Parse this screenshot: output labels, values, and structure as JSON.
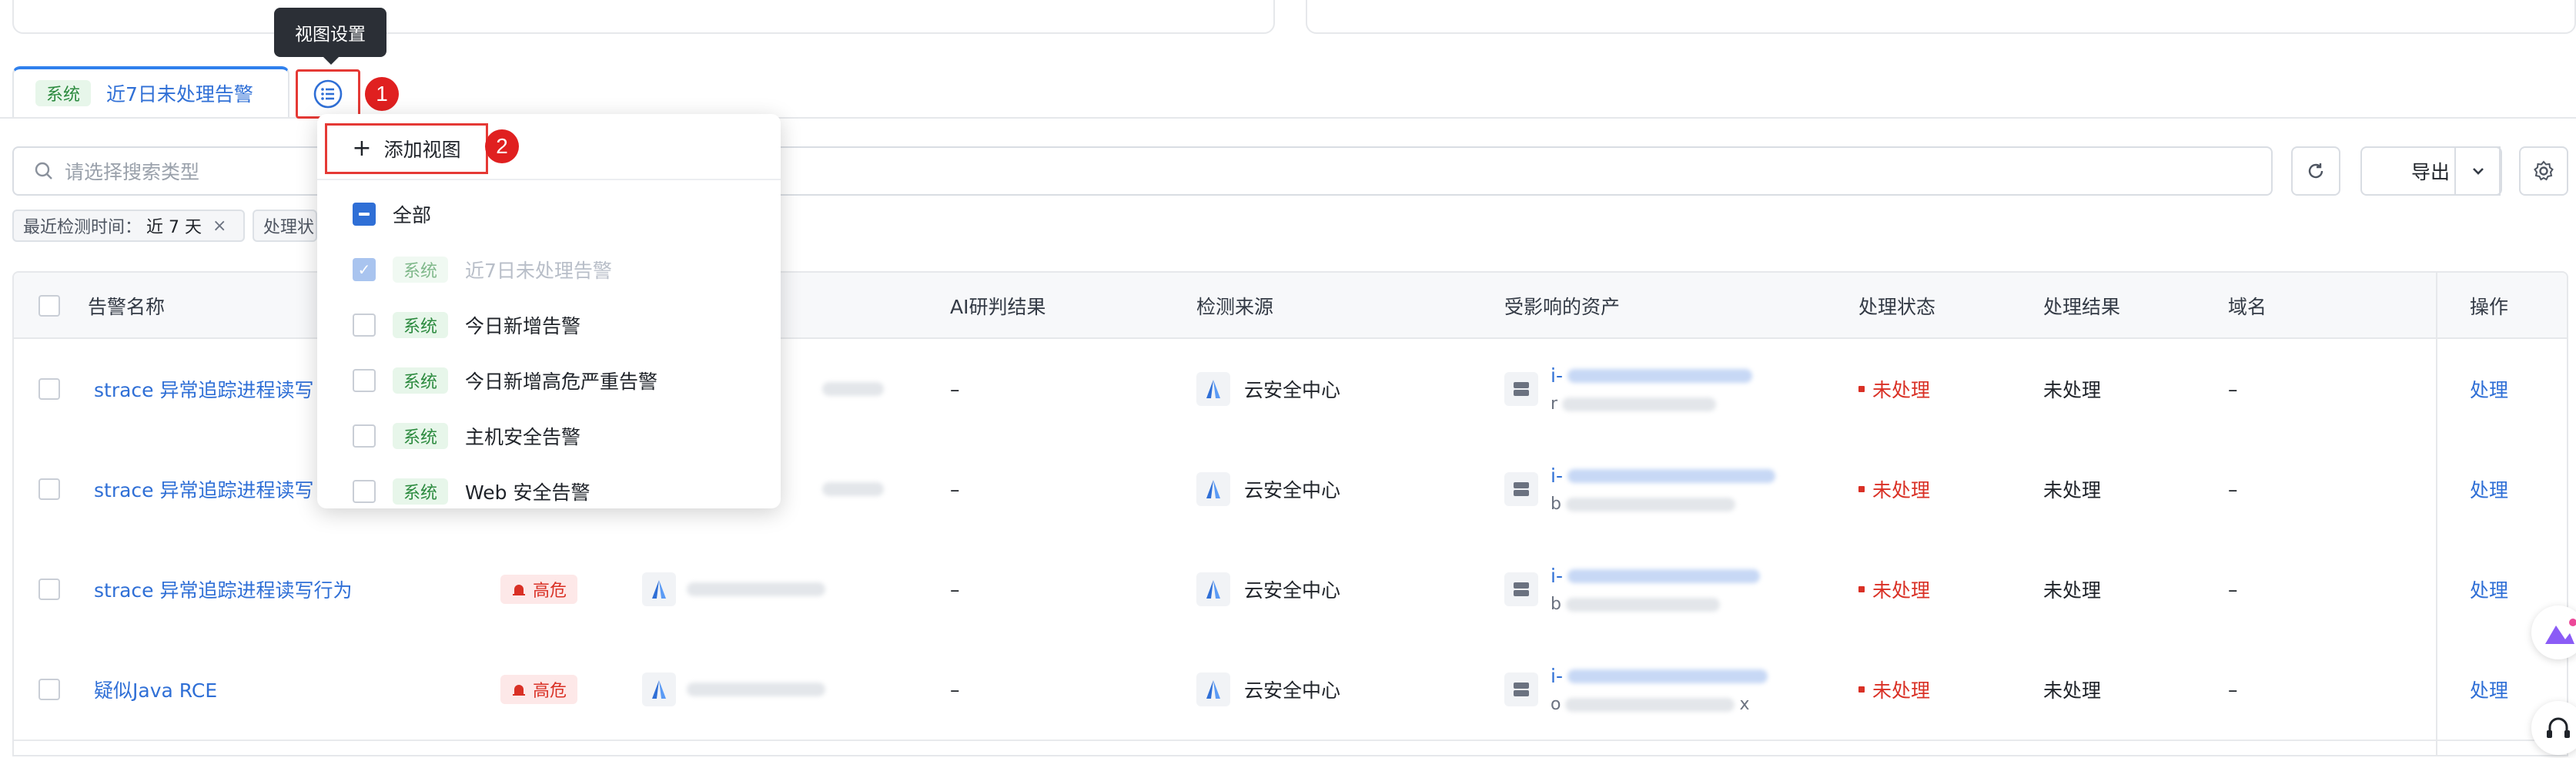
{
  "tooltip": "视图设置",
  "tabs": [
    {
      "tag": "系统",
      "label": "近7日未处理告警"
    },
    {
      "marker": "1"
    }
  ],
  "dropdown": {
    "add_view_label": "添加视图",
    "add_marker": "2",
    "items": [
      {
        "label": "全部",
        "state": "indeterminate",
        "tag": ""
      },
      {
        "label": "近7日未处理告警",
        "state": "checked-disabled",
        "tag": "系统"
      },
      {
        "label": "今日新增告警",
        "state": "unchecked",
        "tag": "系统"
      },
      {
        "label": "今日新增高危严重告警",
        "state": "unchecked",
        "tag": "系统"
      },
      {
        "label": "主机安全告警",
        "state": "unchecked",
        "tag": "系统"
      },
      {
        "label": "Web 安全告警",
        "state": "unchecked",
        "tag": "系统"
      }
    ]
  },
  "search": {
    "placeholder": "请选择搜索类型"
  },
  "toolbar": {
    "export_label": "导出"
  },
  "filters": [
    {
      "label": "最近检测时间：",
      "value": "近 7 天"
    },
    {
      "label": "处理状"
    }
  ],
  "table": {
    "headers": {
      "name": "告警名称",
      "ai": "AI研判结果",
      "source": "检测来源",
      "asset": "受影响的资产",
      "status": "处理状态",
      "result": "处理结果",
      "domain": "域名",
      "op": "操作"
    },
    "rows": [
      {
        "name": "strace 异常追踪进程读写",
        "risk": "",
        "ai": "–",
        "source": "云安全中心",
        "asset_prefix": "i-",
        "asset_sub_prefix": "r",
        "status": "未处理",
        "result": "未处理",
        "domain": "–",
        "op": "处理"
      },
      {
        "name": "strace 异常追踪进程读写",
        "risk": "",
        "ai": "–",
        "source": "云安全中心",
        "asset_prefix": "i-",
        "asset_sub_prefix": "b",
        "status": "未处理",
        "result": "未处理",
        "domain": "–",
        "op": "处理"
      },
      {
        "name": "strace 异常追踪进程读写行为",
        "risk": "高危",
        "ai": "–",
        "source": "云安全中心",
        "asset_prefix": "i-",
        "asset_sub_prefix": "b",
        "status": "未处理",
        "result": "未处理",
        "domain": "–",
        "op": "处理"
      },
      {
        "name": "疑似Java RCE",
        "risk": "高危",
        "ai": "–",
        "source": "云安全中心",
        "asset_prefix": "i-",
        "asset_sub_prefix": "o",
        "asset_sub_suffix": "x",
        "status": "未处理",
        "result": "未处理",
        "domain": "–",
        "op": "处理"
      }
    ]
  },
  "colors": {
    "accent": "#2f6fd6",
    "danger": "#d93025",
    "annotation": "#e53935"
  }
}
